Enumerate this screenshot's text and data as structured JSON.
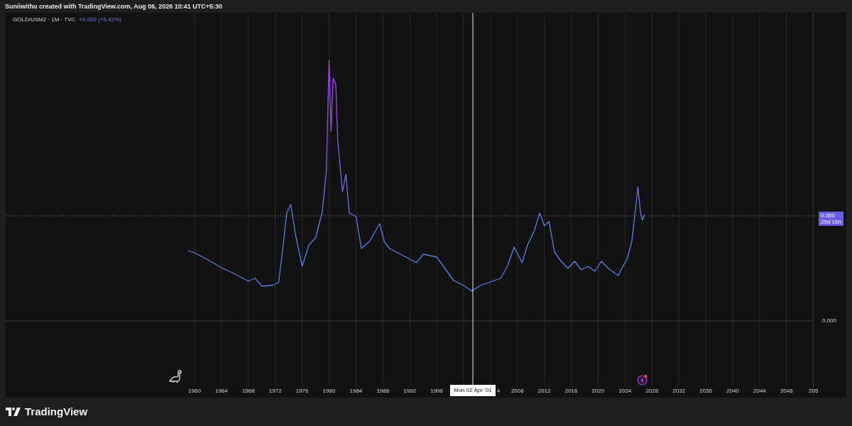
{
  "header": {
    "attribution": "Suniiwithu created with TradingView.com, Aug 06, 2026 10:41 UTC+5:30"
  },
  "legend": {
    "symbol": "GOLD/USM2 · 1M · TVC",
    "change": "+0.000 (+5.42%)"
  },
  "price_axis": {
    "last_price": "0.000",
    "countdown": "25d 16h",
    "tick": "0.000"
  },
  "time_axis": {
    "labels": [
      "1960",
      "1964",
      "1968",
      "1972",
      "1976",
      "1980",
      "1984",
      "1988",
      "1992",
      "1996",
      "4",
      "2008",
      "2012",
      "2016",
      "2020",
      "2024",
      "2028",
      "2032",
      "2036",
      "2040",
      "2044",
      "2048",
      "205"
    ]
  },
  "crosshair": {
    "label": "Mon 02 Apr '01"
  },
  "footer": {
    "brand": "TradingView"
  }
}
